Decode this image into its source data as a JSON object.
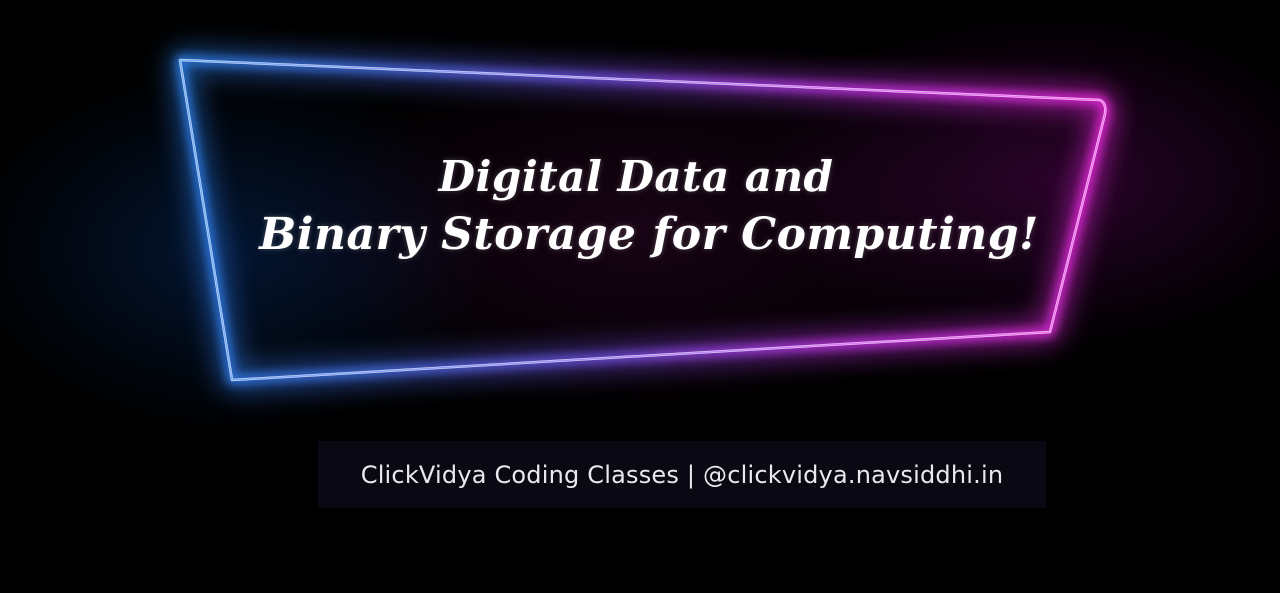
{
  "banner": {
    "title_line_1": "Digital Data and",
    "title_line_2": "Binary Storage for Computing!",
    "caption": "ClickVidya Coding Classes | @clickvidya.navsiddhi.in"
  },
  "colors": {
    "background": "#000000",
    "neon_blue": "#2f8cff",
    "neon_magenta": "#ff2df2",
    "caption_box": "#0a0812",
    "title_text": "#ffffff",
    "caption_text": "#e8e8ee"
  }
}
